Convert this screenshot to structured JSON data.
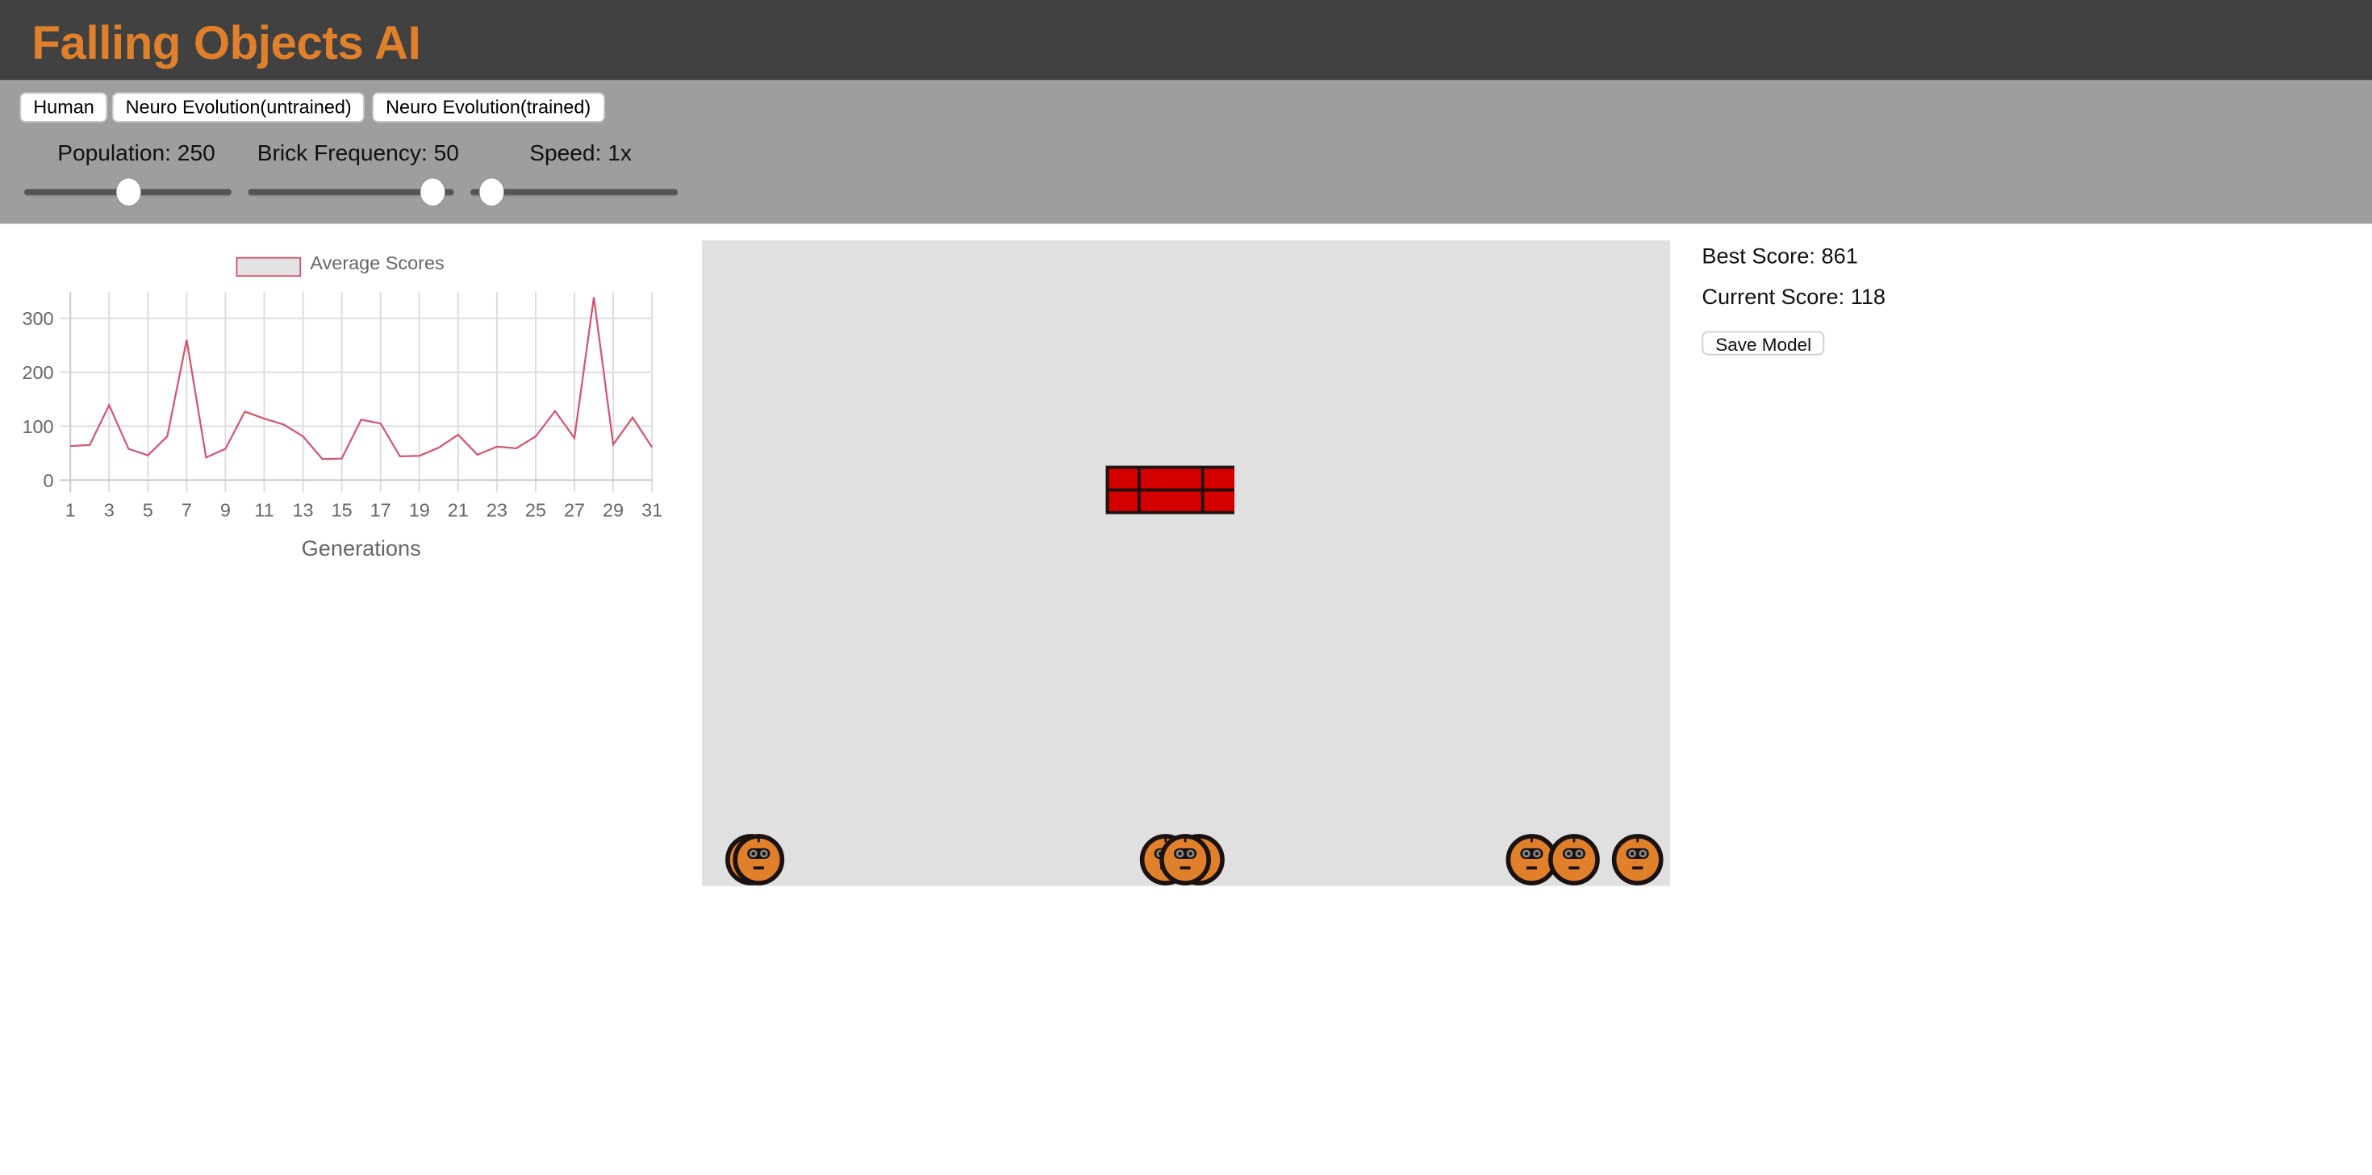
{
  "app": {
    "title": "Falling Objects AI",
    "accent_color": "#e0802b",
    "header_bg": "#414141",
    "controls_bg": "#9e9e9e"
  },
  "modes": [
    {
      "label": "Human"
    },
    {
      "label": "Neuro Evolution(untrained)"
    },
    {
      "label": "Neuro Evolution(trained)"
    }
  ],
  "sliders": {
    "population": {
      "label": "Population: 250",
      "value": 250,
      "fill_fraction": 0.5
    },
    "brick_frequency": {
      "label": "Brick Frequency: 50",
      "value": 50,
      "fill_fraction": 0.95
    },
    "speed": {
      "label": "Speed: 1x",
      "value": "1x",
      "fill_fraction": 0.05
    }
  },
  "stats": {
    "best_score": "Best Score: 861",
    "current_score": "Current Score: 118",
    "save_label": "Save Model"
  },
  "game": {
    "background": "#e0e0e0",
    "brick_color": "#d40000",
    "player_color": "#e0802b",
    "player_count_visible": 8
  },
  "chart_data": {
    "type": "line",
    "title": "",
    "legend": [
      "Average Scores"
    ],
    "legend_position": "top",
    "xlabel": "Generations",
    "ylabel": "",
    "x": [
      1,
      2,
      3,
      4,
      5,
      6,
      7,
      8,
      9,
      10,
      11,
      12,
      13,
      14,
      15,
      16,
      17,
      18,
      19,
      20,
      21,
      22,
      23,
      24,
      25,
      26,
      27,
      28,
      29,
      30,
      31
    ],
    "x_tick_labels": [
      "1",
      "3",
      "5",
      "7",
      "9",
      "11",
      "13",
      "15",
      "17",
      "19",
      "21",
      "23",
      "25",
      "27",
      "29",
      "31"
    ],
    "y_tick_labels": [
      "0",
      "100",
      "200",
      "300"
    ],
    "ylim": [
      0,
      350
    ],
    "grid": true,
    "series": [
      {
        "name": "Average Scores",
        "color": "#d4566e",
        "values": [
          63,
          65,
          139,
          58,
          46,
          81,
          260,
          42,
          58,
          127,
          114,
          103,
          81,
          39,
          40,
          112,
          105,
          44,
          45,
          60,
          84,
          47,
          62,
          59,
          81,
          128,
          78,
          339,
          66,
          116,
          61
        ]
      }
    ]
  }
}
